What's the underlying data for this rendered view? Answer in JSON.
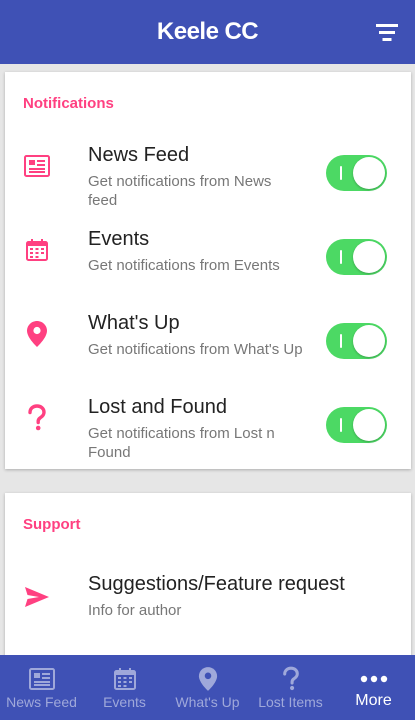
{
  "app_bar": {
    "title_part1": "Keele",
    "title_part2": "CC"
  },
  "notifications": {
    "section_title": "Notifications",
    "items": [
      {
        "title": "News Feed",
        "subtitle": "Get notifications from News feed",
        "enabled": true,
        "icon": "newspaper-icon"
      },
      {
        "title": "Events",
        "subtitle": "Get notifications from Events",
        "enabled": true,
        "icon": "calendar-icon"
      },
      {
        "title": "What's Up",
        "subtitle": "Get notifications from What's Up",
        "enabled": true,
        "icon": "location-pin-icon"
      },
      {
        "title": "Lost and Found",
        "subtitle": "Get notifications from Lost n Found",
        "enabled": true,
        "icon": "question-mark-icon"
      }
    ]
  },
  "support": {
    "section_title": "Support",
    "items": [
      {
        "title": "Suggestions/Feature request",
        "subtitle": "Info for author",
        "icon": "send-icon"
      }
    ]
  },
  "bottom_nav": {
    "items": [
      {
        "label": "News Feed",
        "icon": "newspaper-icon",
        "active": false
      },
      {
        "label": "Events",
        "icon": "calendar-icon",
        "active": false
      },
      {
        "label": "What's Up",
        "icon": "location-pin-icon",
        "active": false
      },
      {
        "label": "Lost Items",
        "icon": "question-mark-icon",
        "active": false
      },
      {
        "label": "More",
        "icon": "more-dots-icon",
        "active": true
      }
    ]
  },
  "colors": {
    "primary": "#3f51b5",
    "accent": "#ff4081",
    "toggle_on": "#4cd964",
    "nav_inactive": "#9fa8da"
  }
}
